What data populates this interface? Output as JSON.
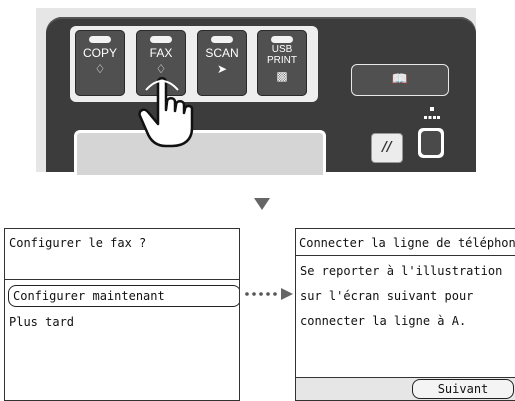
{
  "panel": {
    "buttons": [
      {
        "label": "COPY"
      },
      {
        "label": "FAX"
      },
      {
        "label": "SCAN"
      },
      {
        "label_line1": "USB",
        "label_line2": "PRINT"
      }
    ],
    "address_book_icon": "book-icon",
    "reset_icon": "reset-icon",
    "menu_icon": "menu-icon",
    "pointer_icon": "hand-pointer-icon",
    "panel_color": "#3c3c3c"
  },
  "screen_left": {
    "title": "Configurer le fax ?",
    "options": [
      "Configurer maintenant",
      "Plus tard"
    ]
  },
  "screen_right": {
    "title": "Connecter la ligne de téléphone",
    "lines": [
      "Se reporter à l'illustration",
      "sur l'écran suivant pour",
      "connecter la ligne à A."
    ],
    "next_label": "Suivant"
  }
}
